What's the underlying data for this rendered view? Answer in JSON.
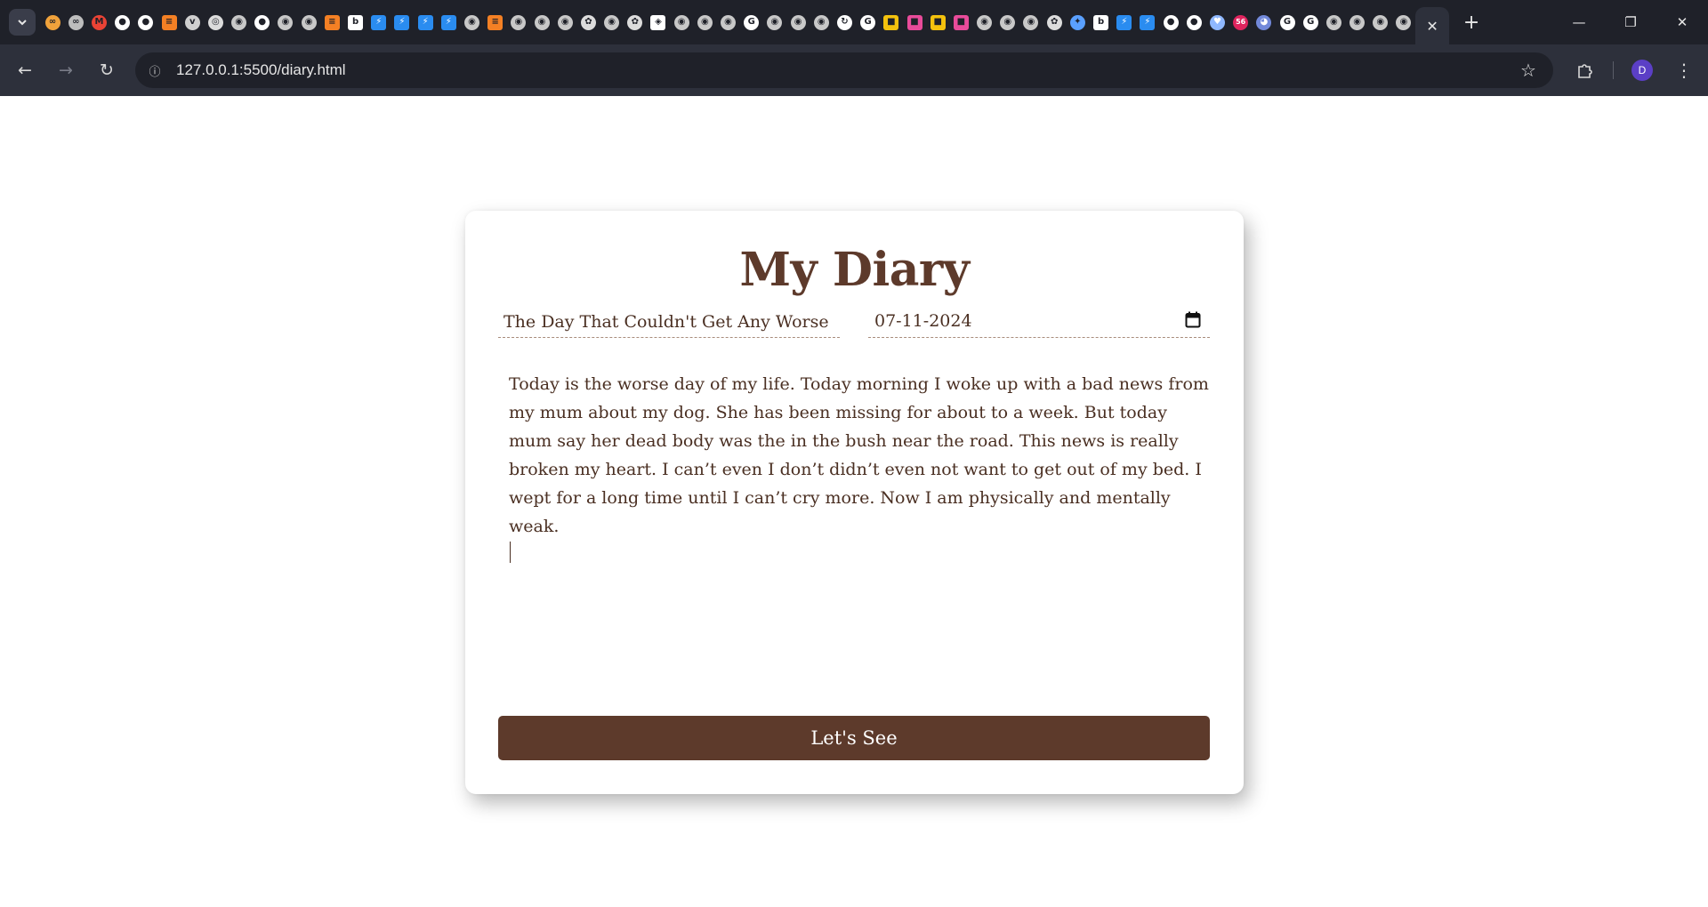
{
  "browser": {
    "tab_search_icon": "chevron-down-icon",
    "pinned_tabs": [
      {
        "icon": "infinity-icon",
        "glyph": "∞",
        "color": "#f0a23b"
      },
      {
        "icon": "infinity-icon",
        "glyph": "∞",
        "color": "#bdbdbd"
      },
      {
        "icon": "gmail-icon",
        "glyph": "M",
        "color": "#ea4335"
      },
      {
        "icon": "github-icon",
        "glyph": "●",
        "color": "#ffffff"
      },
      {
        "icon": "github-icon",
        "glyph": "●",
        "color": "#ffffff"
      },
      {
        "icon": "stackoverflow-icon",
        "glyph": "≡",
        "color": "#f48024"
      },
      {
        "icon": "vivaldi-icon",
        "glyph": "v",
        "color": "#cfcfcf"
      },
      {
        "icon": "chrome-icon",
        "glyph": "◎",
        "color": "#dcdcdc"
      },
      {
        "icon": "globe-icon",
        "glyph": "◉",
        "color": "#c8c8c8"
      },
      {
        "icon": "github-icon",
        "glyph": "●",
        "color": "#ffffff"
      },
      {
        "icon": "globe-icon",
        "glyph": "◉",
        "color": "#c8c8c8"
      },
      {
        "icon": "globe-icon",
        "glyph": "◉",
        "color": "#c8c8c8"
      },
      {
        "icon": "stackoverflow-icon",
        "glyph": "≡",
        "color": "#f48024"
      },
      {
        "icon": "bing-icon",
        "glyph": "b",
        "color": "#ffffff"
      },
      {
        "icon": "bolt-icon",
        "glyph": "⚡",
        "color": "#2a8cf0"
      },
      {
        "icon": "bolt-icon",
        "glyph": "⚡",
        "color": "#2a8cf0"
      },
      {
        "icon": "bolt-icon",
        "glyph": "⚡",
        "color": "#2a8cf0"
      },
      {
        "icon": "bolt-icon",
        "glyph": "⚡",
        "color": "#2a8cf0"
      },
      {
        "icon": "globe-icon",
        "glyph": "◉",
        "color": "#c8c8c8"
      },
      {
        "icon": "stackoverflow-icon",
        "glyph": "≡",
        "color": "#f48024"
      },
      {
        "icon": "globe-icon",
        "glyph": "◉",
        "color": "#c8c8c8"
      },
      {
        "icon": "globe-icon",
        "glyph": "◉",
        "color": "#c8c8c8"
      },
      {
        "icon": "globe-icon",
        "glyph": "◉",
        "color": "#c8c8c8"
      },
      {
        "icon": "openai-icon",
        "glyph": "✿",
        "color": "#dcdcdc"
      },
      {
        "icon": "globe-icon",
        "glyph": "◉",
        "color": "#c8c8c8"
      },
      {
        "icon": "openai-icon",
        "glyph": "✿",
        "color": "#dcdcdc"
      },
      {
        "icon": "codepen-icon",
        "glyph": "◈",
        "color": "#ffffff"
      },
      {
        "icon": "globe-icon",
        "glyph": "◉",
        "color": "#c8c8c8"
      },
      {
        "icon": "globe-icon",
        "glyph": "◉",
        "color": "#c8c8c8"
      },
      {
        "icon": "globe-icon",
        "glyph": "◉",
        "color": "#c8c8c8"
      },
      {
        "icon": "google-icon",
        "glyph": "G",
        "color": "#ffffff"
      },
      {
        "icon": "globe-icon",
        "glyph": "◉",
        "color": "#c8c8c8"
      },
      {
        "icon": "globe-icon",
        "glyph": "◉",
        "color": "#c8c8c8"
      },
      {
        "icon": "globe-icon",
        "glyph": "◉",
        "color": "#c8c8c8"
      },
      {
        "icon": "refresh-circle-icon",
        "glyph": "↻",
        "color": "#ffffff"
      },
      {
        "icon": "google-icon",
        "glyph": "G",
        "color": "#ffffff"
      },
      {
        "icon": "colorful-app-icon",
        "glyph": "■",
        "color": "#f4c20d"
      },
      {
        "icon": "colorful-app-icon",
        "glyph": "■",
        "color": "#e94b9a"
      },
      {
        "icon": "colorful-app-icon",
        "glyph": "■",
        "color": "#f4c20d"
      },
      {
        "icon": "colorful-app-icon",
        "glyph": "■",
        "color": "#e94b9a"
      },
      {
        "icon": "globe-icon",
        "glyph": "◉",
        "color": "#c8c8c8"
      },
      {
        "icon": "globe-icon",
        "glyph": "◉",
        "color": "#c8c8c8"
      },
      {
        "icon": "globe-icon",
        "glyph": "◉",
        "color": "#c8c8c8"
      },
      {
        "icon": "openai-icon",
        "glyph": "✿",
        "color": "#dcdcdc"
      },
      {
        "icon": "sparkle-icon",
        "glyph": "✦",
        "color": "#5aa0ff"
      },
      {
        "icon": "bing-icon",
        "glyph": "b",
        "color": "#ffffff"
      },
      {
        "icon": "bolt-icon",
        "glyph": "⚡",
        "color": "#2a8cf0"
      },
      {
        "icon": "bolt-icon",
        "glyph": "⚡",
        "color": "#2a8cf0"
      },
      {
        "icon": "github-icon",
        "glyph": "●",
        "color": "#ffffff"
      },
      {
        "icon": "github-icon",
        "glyph": "●",
        "color": "#ffffff"
      },
      {
        "icon": "heart-icon",
        "glyph": "♥",
        "color": "#8fb8ff"
      },
      {
        "icon": "badge-icon",
        "glyph": "56",
        "color": "#e0245e"
      },
      {
        "icon": "discord-icon",
        "glyph": "◕",
        "color": "#7289da"
      },
      {
        "icon": "google-icon",
        "glyph": "G",
        "color": "#ffffff"
      },
      {
        "icon": "google-icon",
        "glyph": "G",
        "color": "#ffffff"
      },
      {
        "icon": "globe-icon",
        "glyph": "◉",
        "color": "#c8c8c8"
      },
      {
        "icon": "globe-icon",
        "glyph": "◉",
        "color": "#c8c8c8"
      },
      {
        "icon": "globe-icon",
        "glyph": "◉",
        "color": "#c8c8c8"
      },
      {
        "icon": "globe-icon",
        "glyph": "◉",
        "color": "#c8c8c8"
      }
    ],
    "active_tab_close_glyph": "✕",
    "new_tab_glyph": "+",
    "window_controls": {
      "minimize": "—",
      "restore": "❐",
      "close": "✕"
    },
    "nav": {
      "back": "←",
      "forward": "→",
      "reload": "↻"
    },
    "site_info_glyph": "ⓘ",
    "url": "127.0.0.1:5500/diary.html",
    "bookmark_glyph": "☆",
    "extensions_glyph": "⧉",
    "profile_initial": "D",
    "menu_glyph": "⋮"
  },
  "diary": {
    "title": "My Diary",
    "entry_title": "The Day That Couldn't Get Any Worse",
    "entry_date": "07-11-2024",
    "entry_body": "Today is the worse day of my life. Today morning I woke up with a bad news from my mum about my dog. She has been missing for about to a week. But today mum say her dead body was the in the bush near the road. This news is really broken my heart. I can’t even I don’t didn’t even not want to get out of my bed. I wept for a long time until I can’t cry more. Now I am physically and mentally weak.",
    "submit_label": "Let's See",
    "colors": {
      "accent": "#5d3a2b",
      "text": "#4a2f22",
      "underline": "#a88c7c"
    }
  }
}
